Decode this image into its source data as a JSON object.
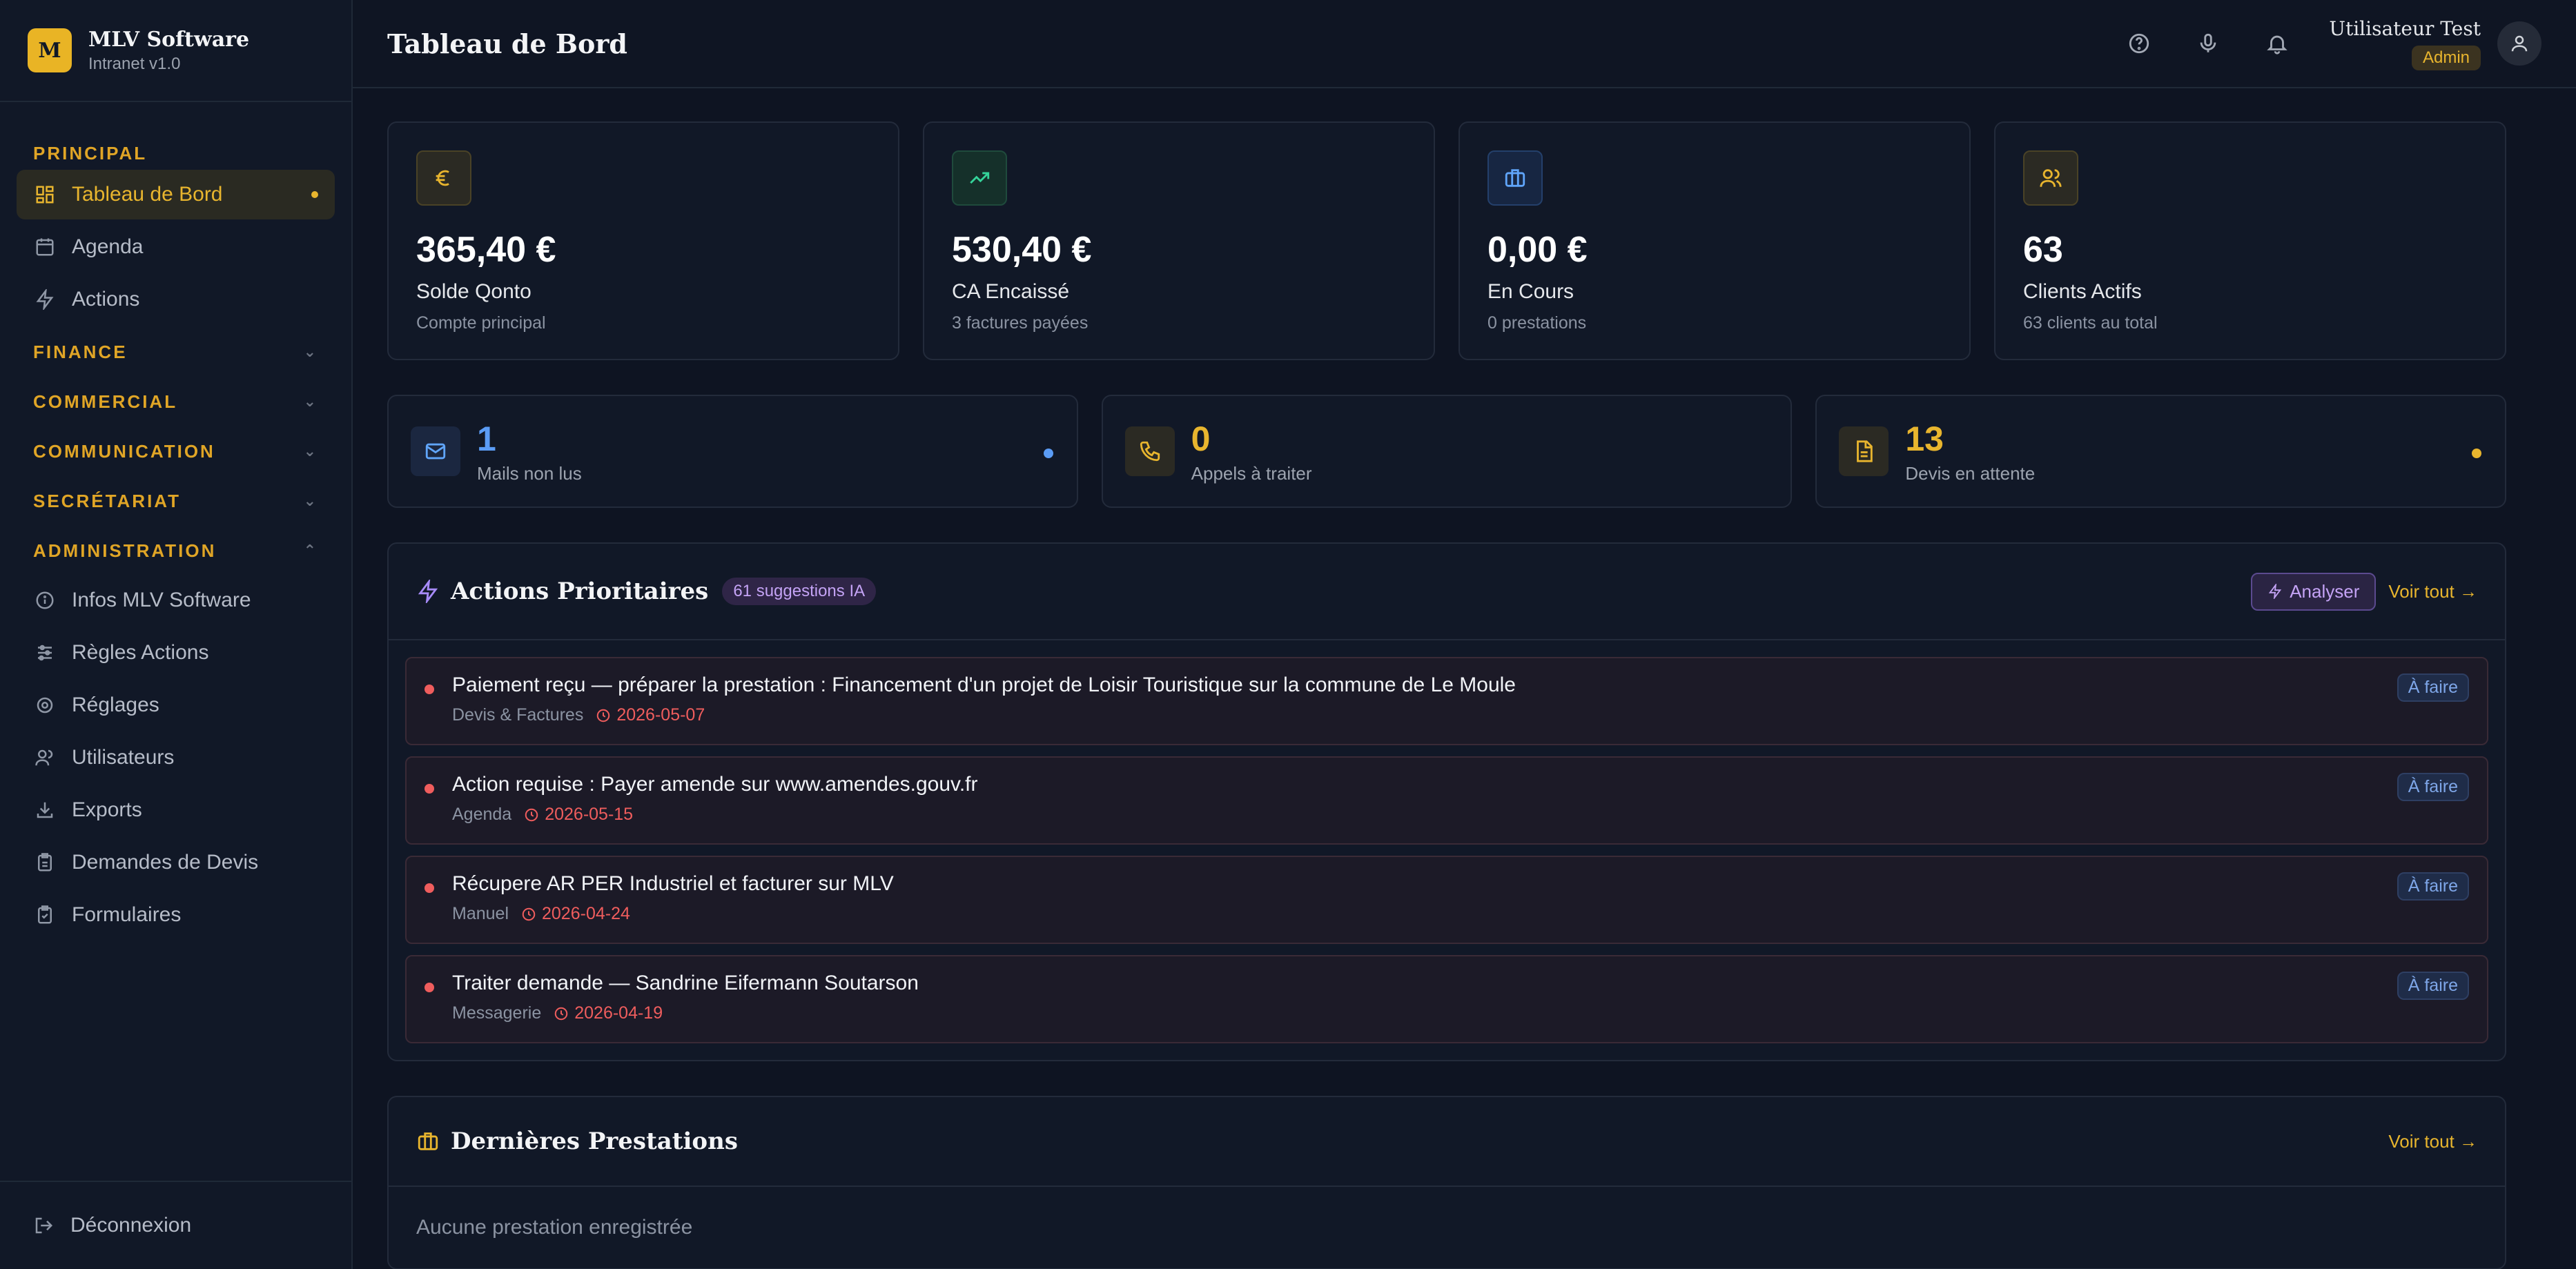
{
  "brand": {
    "logo_letter": "M",
    "name": "MLV Software",
    "sub": "Intranet v1.0"
  },
  "sidebar": {
    "principal_title": "PRINCIPAL",
    "items_principal": [
      {
        "label": "Tableau de Bord",
        "icon": "dashboard-icon"
      },
      {
        "label": "Agenda",
        "icon": "calendar-icon"
      },
      {
        "label": "Actions",
        "icon": "bolt-icon"
      }
    ],
    "sections": [
      "FINANCE",
      "COMMERCIAL",
      "COMMUNICATION",
      "SECRÉTARIAT",
      "ADMINISTRATION"
    ],
    "items_admin": [
      {
        "label": "Infos MLV Software",
        "icon": "info-icon"
      },
      {
        "label": "Règles Actions",
        "icon": "sliders-icon"
      },
      {
        "label": "Réglages",
        "icon": "gear-icon"
      },
      {
        "label": "Utilisateurs",
        "icon": "users-icon"
      },
      {
        "label": "Exports",
        "icon": "download-icon"
      },
      {
        "label": "Demandes de Devis",
        "icon": "clipboard-icon"
      },
      {
        "label": "Formulaires",
        "icon": "form-icon"
      }
    ],
    "logout": "Déconnexion"
  },
  "header": {
    "title": "Tableau de Bord",
    "user_name": "Utilisateur Test",
    "user_role": "Admin"
  },
  "stats": [
    {
      "value": "365,40 €",
      "label": "Solde Qonto",
      "sub": "Compte principal",
      "icon": "euro-icon"
    },
    {
      "value": "530,40 €",
      "label": "CA Encaissé",
      "sub": "3 factures payées",
      "icon": "trending-up-icon"
    },
    {
      "value": "0,00 €",
      "label": "En Cours",
      "sub": "0 prestations",
      "icon": "briefcase-icon"
    },
    {
      "value": "63",
      "label": "Clients Actifs",
      "sub": "63 clients au total",
      "icon": "users-icon"
    }
  ],
  "quick": [
    {
      "value": "1",
      "label": "Mails non lus",
      "icon": "mail-icon"
    },
    {
      "value": "0",
      "label": "Appels à traiter",
      "icon": "phone-icon"
    },
    {
      "value": "13",
      "label": "Devis en attente",
      "icon": "document-icon"
    }
  ],
  "actions_panel": {
    "title": "Actions Prioritaires",
    "badge": "61 suggestions IA",
    "analyse": "Analyser",
    "see_all": "Voir tout →",
    "items": [
      {
        "title": "Paiement reçu — préparer la prestation : Financement d'un projet de Loisir Touristique sur la commune de Le Moule",
        "source": "Devis & Factures",
        "date": "2026-05-07",
        "status": "À faire"
      },
      {
        "title": "Action requise : Payer amende sur www.amendes.gouv.fr",
        "source": "Agenda",
        "date": "2026-05-15",
        "status": "À faire"
      },
      {
        "title": "Récupere AR PER Industriel et facturer sur MLV",
        "source": "Manuel",
        "date": "2026-04-24",
        "status": "À faire"
      },
      {
        "title": "Traiter demande — Sandrine Eifermann Soutarson",
        "source": "Messagerie",
        "date": "2026-04-19",
        "status": "À faire"
      }
    ]
  },
  "prestations_panel": {
    "title": "Dernières Prestations",
    "see_all": "Voir tout →",
    "empty": "Aucune prestation enregistrée"
  }
}
